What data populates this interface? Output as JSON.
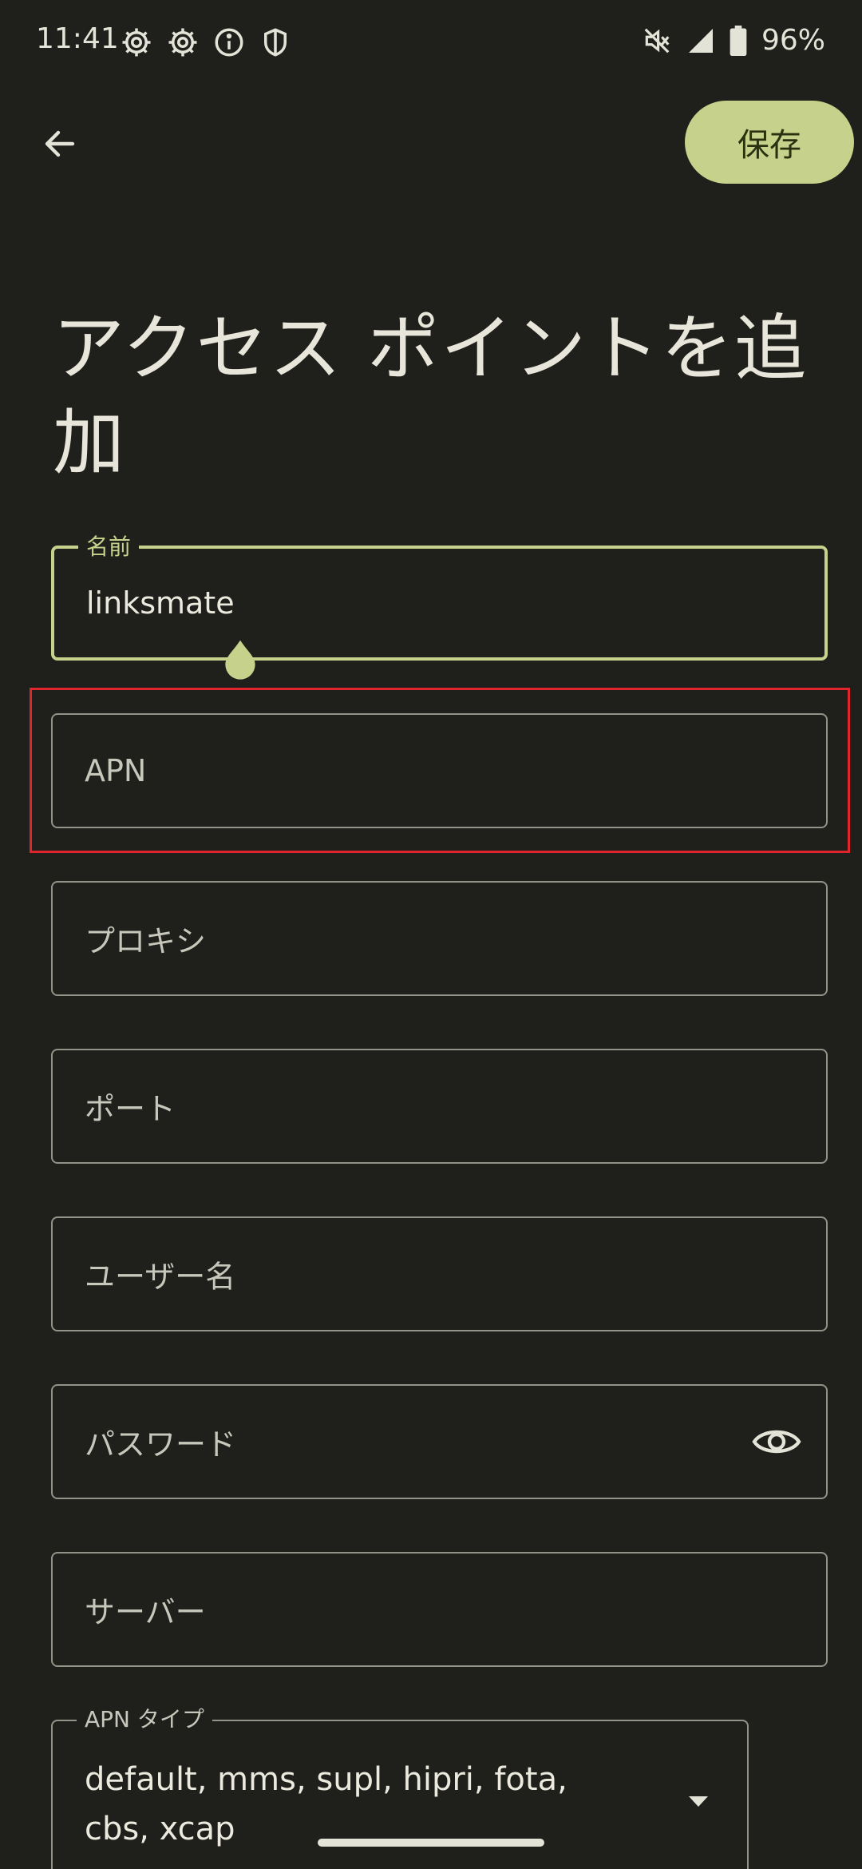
{
  "status_bar": {
    "time": "11:41",
    "battery_percent": "96%",
    "left_icons": [
      "gear-icon",
      "gear-icon",
      "info-icon",
      "shield-icon"
    ],
    "right_icons": [
      "mute-icon",
      "signal-icon",
      "battery-icon"
    ]
  },
  "toolbar": {
    "save_label": "保存"
  },
  "page_title": "アクセス ポイントを追加",
  "fields": {
    "name": {
      "label": "名前",
      "value": "linksmate"
    },
    "apn": {
      "placeholder": "APN"
    },
    "proxy": {
      "placeholder": "プロキシ"
    },
    "port": {
      "placeholder": "ポート"
    },
    "username": {
      "placeholder": "ユーザー名"
    },
    "password": {
      "placeholder": "パスワード"
    },
    "server": {
      "placeholder": "サーバー"
    },
    "apn_type": {
      "label": "APN タイプ",
      "value_line1": "default, mms, supl, hipri, fota,",
      "value_line2": "cbs, xcap"
    }
  },
  "colors": {
    "background": "#1f201b",
    "accent": "#c6d28b",
    "outline": "#919387",
    "highlight": "#e0242b"
  }
}
